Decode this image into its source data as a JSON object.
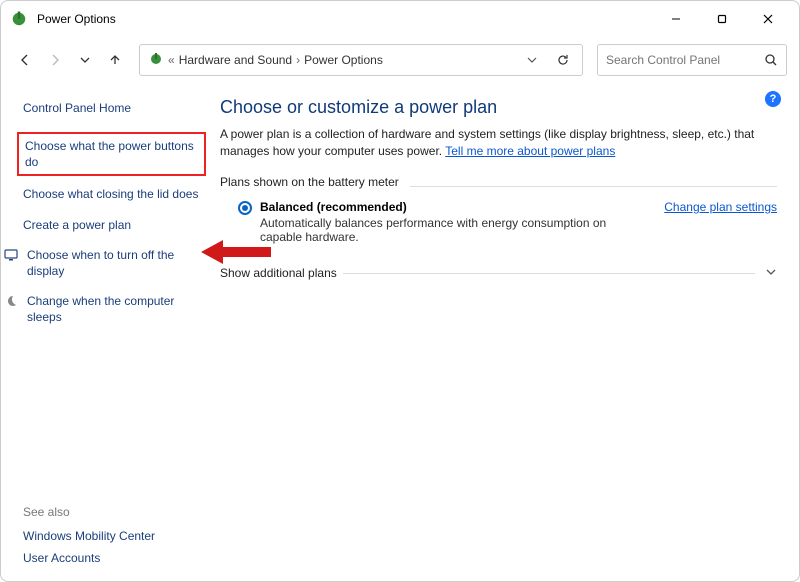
{
  "window": {
    "title": "Power Options"
  },
  "breadcrumb": {
    "level1": "Hardware and Sound",
    "level2": "Power Options"
  },
  "search": {
    "placeholder": "Search Control Panel"
  },
  "sidebar": {
    "home": "Control Panel Home",
    "links": {
      "power_buttons": "Choose what the power buttons do",
      "closing_lid": "Choose what closing the lid does",
      "create_plan": "Create a power plan",
      "turn_off_display": "Choose when to turn off the display",
      "computer_sleeps": "Change when the computer sleeps"
    },
    "see_also": "See also",
    "footer": {
      "mobility": "Windows Mobility Center",
      "accounts": "User Accounts"
    }
  },
  "main": {
    "heading": "Choose or customize a power plan",
    "desc_prefix": "A power plan is a collection of hardware and system settings (like display brightness, sleep, etc.) that manages how your computer uses power. ",
    "desc_link": "Tell me more about power plans",
    "section_label": "Plans shown on the battery meter",
    "plan": {
      "name": "Balanced (recommended)",
      "desc": "Automatically balances performance with energy consumption on capable hardware.",
      "change": "Change plan settings"
    },
    "show_more": "Show additional plans"
  }
}
